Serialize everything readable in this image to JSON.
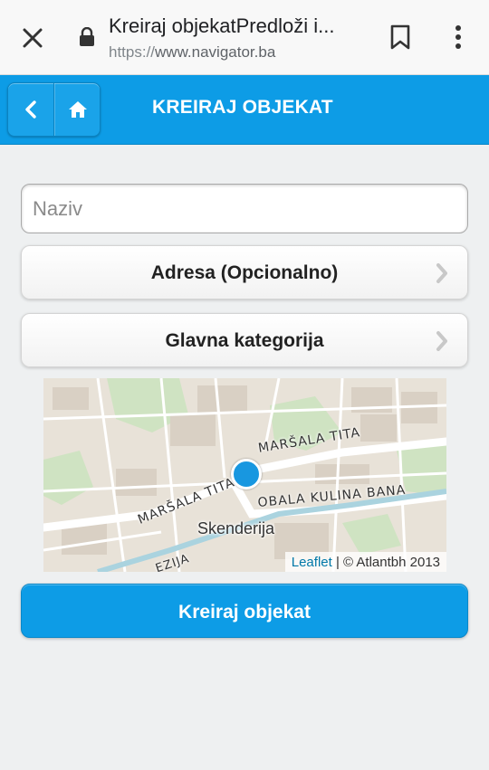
{
  "browser": {
    "page_title": "Kreiraj objekatPredloži i...",
    "url_protocol": "https://",
    "url_host": "www.navigator.ba",
    "icons": [
      "close-icon",
      "lock-icon",
      "bookmark-icon",
      "more-vert-icon"
    ]
  },
  "header": {
    "title": "KREIRAJ OBJEKAT",
    "back_icon": "chevron-left-icon",
    "home_icon": "home-icon",
    "color": "#0d9ce6"
  },
  "form": {
    "name_placeholder": "Naziv",
    "name_value": "",
    "address_label": "Adresa (Opcionalno)",
    "category_label": "Glavna kategorija",
    "submit_label": "Kreiraj objekat"
  },
  "map": {
    "streets": {
      "marsala_tita_1": "MARŠALA TITA",
      "marsala_tita_2": "MARŠALA TITA",
      "obala": "OBALA KULINA BANA",
      "terezija": "EZIJA"
    },
    "district": "Skenderija",
    "attribution_link": "Leaflet",
    "attribution_text": " | © Atlantbh 2013",
    "marker_color": "#1897e0"
  }
}
